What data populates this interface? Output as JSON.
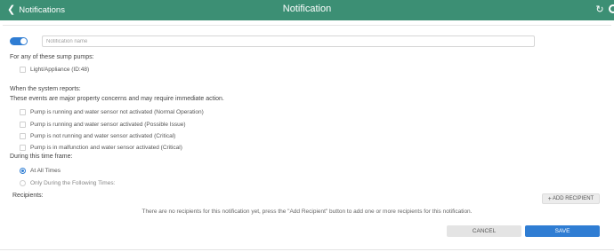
{
  "header": {
    "back_label": "Notifications",
    "title": "Notification",
    "refresh_icon": "refresh-icon",
    "bg_color": "#3c8f74"
  },
  "form": {
    "enabled": true,
    "name_placeholder": "Notification name",
    "name_value": "",
    "pumps_heading": "For any of these sump pumps:",
    "pumps": [
      {
        "label": "Light/Appliance (ID:48)",
        "checked": false
      }
    ],
    "system_heading": "When the system reports:",
    "system_note": "These events are major property concerns and may require immediate action.",
    "events": [
      {
        "label": "Pump is running and water sensor not activated (Normal Operation)",
        "checked": false
      },
      {
        "label": "Pump is running and water sensor activated (Possible Issue)",
        "checked": false
      },
      {
        "label": "Pump is not running and water sensor activated (Critical)",
        "checked": false
      },
      {
        "label": "Pump is in malfunction and water sensor activated (Critical)",
        "checked": false
      }
    ],
    "timeframe_heading": "During this time frame:",
    "timeframes": [
      {
        "label": "At All Times",
        "selected": true
      },
      {
        "label": "Only During the Following Times:",
        "selected": false
      }
    ],
    "recipients_label": "Recipients:",
    "add_recipient_label": "ADD RECIPIENT",
    "empty_recipients_message": "There are no recipients for this notification yet, press the \"Add Recipient\" button to add one or more recipients for this notification.",
    "cancel_label": "CANCEL",
    "save_label": "SAVE",
    "accent_color": "#2f7dd3"
  }
}
